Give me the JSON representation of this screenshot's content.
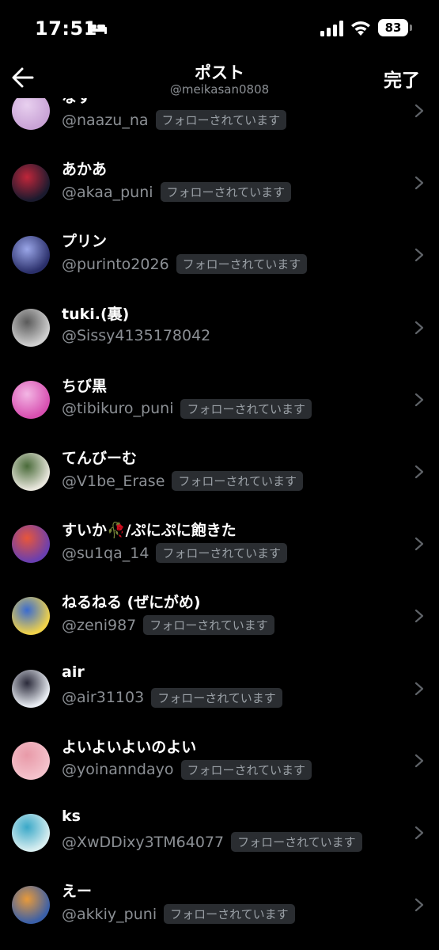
{
  "status": {
    "time": "17:51",
    "battery": "83"
  },
  "nav": {
    "title": "ポスト",
    "subtitle": "@meikasan0808",
    "done_label": "完了"
  },
  "users": [
    {
      "name": "なす",
      "handle": "@naazu_na",
      "badge": "フォローされています",
      "avatar_colors": [
        "#c9a3d6",
        "#e8d0ef"
      ]
    },
    {
      "name": "あかあ",
      "handle": "@akaa_puni",
      "badge": "フォローされています",
      "avatar_colors": [
        "#1a1a2e",
        "#c0263a"
      ]
    },
    {
      "name": "プリン",
      "handle": "@purinto2026",
      "badge": "フォローされています",
      "avatar_colors": [
        "#2a2f6a",
        "#9aa6e8"
      ]
    },
    {
      "name": "tuki.(裏)",
      "handle": "@Sissy4135178042",
      "badge": "",
      "avatar_colors": [
        "#cfcfcf",
        "#5a5a5a"
      ]
    },
    {
      "name": "ちび黒",
      "handle": "@tibikuro_puni",
      "badge": "フォローされています",
      "avatar_colors": [
        "#d74fb0",
        "#f3b6e4"
      ]
    },
    {
      "name": "てんびーむ",
      "handle": "@V1be_Erase",
      "badge": "フォローされています",
      "avatar_colors": [
        "#e8e6dc",
        "#4a6b3a"
      ]
    },
    {
      "name": "すいか🥀/ぷにぷに飽きた",
      "handle": "@su1qa_14",
      "badge": "フォローされています",
      "avatar_colors": [
        "#6a3fb0",
        "#e8563a"
      ]
    },
    {
      "name": "ねるねる (ぜにがめ)",
      "handle": "@zeni987",
      "badge": "フォローされています",
      "avatar_colors": [
        "#f0d24a",
        "#3a6bd0"
      ]
    },
    {
      "name": "air",
      "handle": "@air31103",
      "badge": "フォローされています",
      "avatar_colors": [
        "#e8ecf2",
        "#2a2a3a"
      ]
    },
    {
      "name": "よいよいよいのよい",
      "handle": "@yoinanndayo",
      "badge": "フォローされています",
      "avatar_colors": [
        "#f4c2cc",
        "#e89aa8"
      ]
    },
    {
      "name": "ks",
      "handle": "@XwDDixy3TM64077",
      "badge": "フォローされています",
      "avatar_colors": [
        "#d8eef0",
        "#3aa8c8"
      ]
    },
    {
      "name": "えー",
      "handle": "@akkiy_puni",
      "badge": "フォローされています",
      "avatar_colors": [
        "#3a5fa8",
        "#e89a3a"
      ]
    }
  ]
}
